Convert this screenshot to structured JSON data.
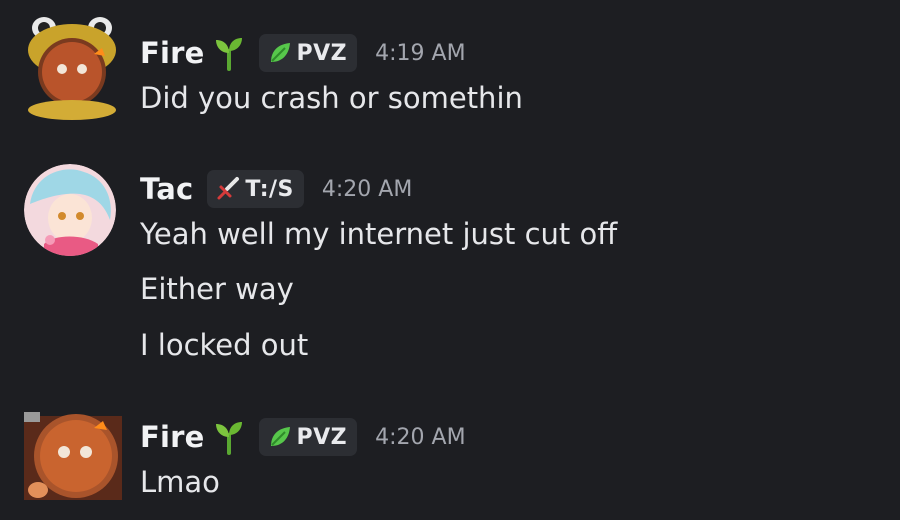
{
  "messages": [
    {
      "username": "Fire",
      "username_emoji": "sprout-icon",
      "tag": "PVZ",
      "tag_icon": "leaf-icon",
      "time": "4:19 AM",
      "lines": [
        "Did you crash or somethin"
      ]
    },
    {
      "username": "Tac",
      "tag": "T:/S",
      "tag_icon": "sword-icon",
      "time": "4:20 AM",
      "lines": [
        "Yeah well my internet just cut off",
        "Either way",
        "I locked out"
      ]
    },
    {
      "username": "Fire",
      "username_emoji": "sprout-icon",
      "tag": "PVZ",
      "tag_icon": "leaf-icon",
      "time": "4:20 AM",
      "lines": [
        "Lmao"
      ]
    }
  ],
  "colors": {
    "background": "#1d1e22",
    "tag_background": "#2c2e33",
    "timestamp": "#a3a6ae",
    "text": "#e6e7ea"
  }
}
